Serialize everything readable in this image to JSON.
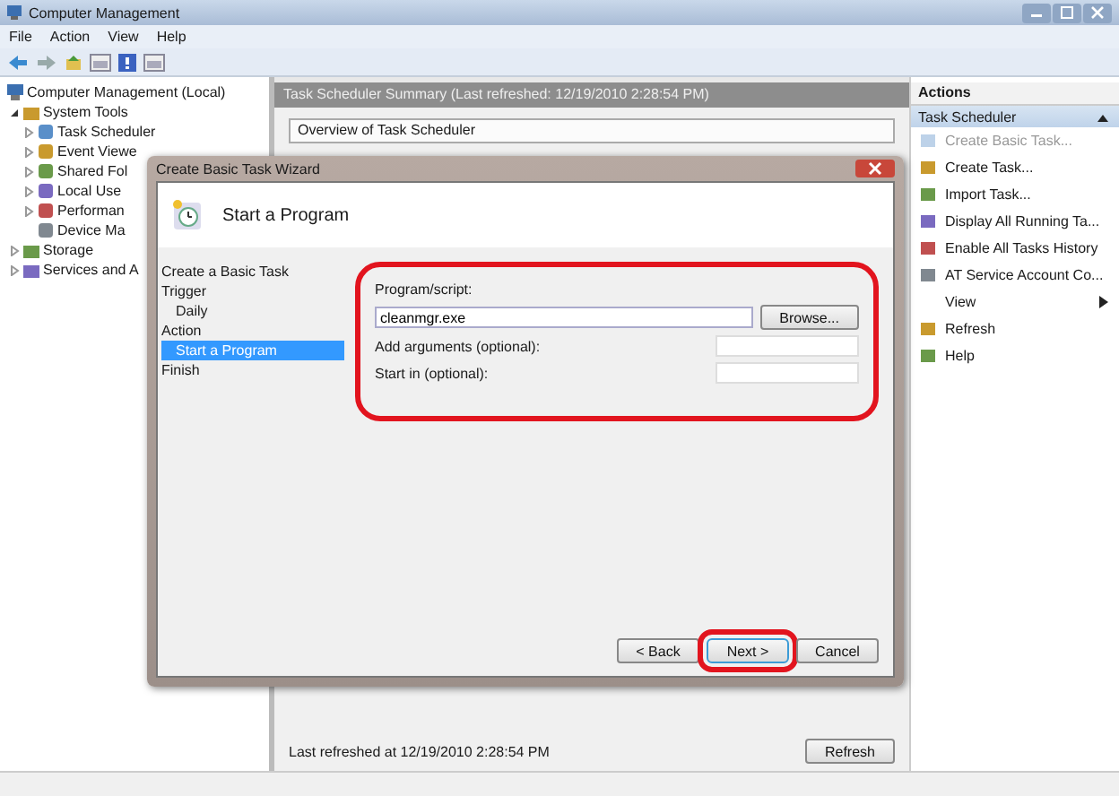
{
  "window": {
    "title": "Computer Management"
  },
  "menu": [
    "File",
    "Action",
    "View",
    "Help"
  ],
  "tree": [
    {
      "label": "Computer Management (Local)",
      "children": [
        {
          "label": "System Tools",
          "expanded": true,
          "children": [
            {
              "label": "Task Scheduler",
              "expanded": false
            },
            {
              "label": "Event Viewe",
              "expanded": false
            },
            {
              "label": "Shared Fol",
              "expanded": false
            },
            {
              "label": "Local Use",
              "expanded": false
            },
            {
              "label": "Performan",
              "expanded": false
            },
            {
              "label": "Device Ma"
            }
          ]
        },
        {
          "label": "Storage",
          "expanded": false
        },
        {
          "label": "Services and A",
          "expanded": false
        }
      ]
    }
  ],
  "summary": {
    "header": "Task Scheduler Summary (Last refreshed: 12/19/2010 2:28:54 PM)",
    "overview": "Overview of Task Scheduler",
    "last_refreshed": "Last refreshed at 12/19/2010 2:28:54 PM",
    "refresh_button": "Refresh"
  },
  "actions": {
    "title": "Actions",
    "section": "Task Scheduler",
    "items": [
      {
        "label": "Create Basic Task...",
        "disabled": true,
        "kind": "item"
      },
      {
        "label": "Create Task...",
        "disabled": false,
        "kind": "item"
      },
      {
        "label": "Import Task...",
        "disabled": false,
        "kind": "item"
      },
      {
        "label": "Display All Running Ta...",
        "disabled": false,
        "kind": "item"
      },
      {
        "label": "Enable All Tasks History",
        "disabled": false,
        "kind": "item"
      },
      {
        "label": "AT Service Account Co...",
        "disabled": false,
        "kind": "item"
      },
      {
        "label": "View",
        "disabled": false,
        "kind": "submenu"
      },
      {
        "label": "Refresh",
        "disabled": false,
        "kind": "item"
      },
      {
        "label": "Help",
        "disabled": false,
        "kind": "item"
      }
    ]
  },
  "dialog": {
    "title": "Create Basic Task Wizard",
    "heading": "Start a Program",
    "steps": [
      {
        "label": "Create a Basic Task",
        "selected": false
      },
      {
        "label": "Trigger",
        "selected": false,
        "children": [
          {
            "label": "Daily",
            "selected": false
          }
        ]
      },
      {
        "label": "Action",
        "selected": false,
        "children": [
          {
            "label": "Start a Program",
            "selected": true
          }
        ]
      },
      {
        "label": "Finish",
        "selected": false
      }
    ],
    "form": {
      "annotated": true,
      "fields": [
        {
          "label": "Program/script:",
          "value": "cleanmgr.exe",
          "button": "Browse..."
        },
        {
          "label": "Add arguments (optional):"
        },
        {
          "label": "Start in (optional):"
        }
      ]
    },
    "buttons": [
      {
        "label": "< Back",
        "focused": false,
        "annotated": false
      },
      {
        "label": "Next >",
        "focused": true,
        "annotated": true
      },
      {
        "label": "Cancel",
        "focused": false,
        "annotated": false
      }
    ]
  }
}
